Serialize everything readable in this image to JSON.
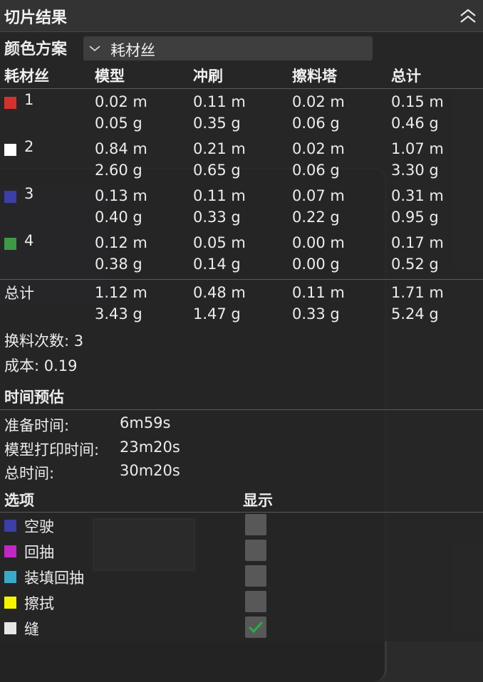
{
  "header": {
    "title": "切片结果"
  },
  "scheme": {
    "label": "颜色方案",
    "value": "耗材丝"
  },
  "columns": [
    "耗材丝",
    "模型",
    "冲刷",
    "擦料塔",
    "总计"
  ],
  "filaments": [
    {
      "id": "1",
      "color": "#d2322d",
      "model": [
        "0.02 m",
        "0.05 g"
      ],
      "flush": [
        "0.11 m",
        "0.35 g"
      ],
      "tower": [
        "0.02 m",
        "0.06 g"
      ],
      "total": [
        "0.15 m",
        "0.46 g"
      ]
    },
    {
      "id": "2",
      "color": "#ffffff",
      "model": [
        "0.84 m",
        "2.60 g"
      ],
      "flush": [
        "0.21 m",
        "0.65 g"
      ],
      "tower": [
        "0.02 m",
        "0.06 g"
      ],
      "total": [
        "1.07 m",
        "3.30 g"
      ]
    },
    {
      "id": "3",
      "color": "#3b3fa6",
      "model": [
        "0.13 m",
        "0.40 g"
      ],
      "flush": [
        "0.11 m",
        "0.33 g"
      ],
      "tower": [
        "0.07 m",
        "0.22 g"
      ],
      "total": [
        "0.31 m",
        "0.95 g"
      ]
    },
    {
      "id": "4",
      "color": "#3e9a45",
      "model": [
        "0.12 m",
        "0.38 g"
      ],
      "flush": [
        "0.05 m",
        "0.14 g"
      ],
      "tower": [
        "0.00 m",
        "0.00 g"
      ],
      "total": [
        "0.17 m",
        "0.52 g"
      ]
    }
  ],
  "totals": {
    "label": "总计",
    "model": [
      "1.12 m",
      "3.43 g"
    ],
    "flush": [
      "0.48 m",
      "1.47 g"
    ],
    "tower": [
      "0.11 m",
      "0.33 g"
    ],
    "total": [
      "1.71 m",
      "5.24 g"
    ]
  },
  "summary": {
    "changes": "换料次数: 3",
    "cost": "成本: 0.19"
  },
  "time": {
    "title": "时间预估",
    "prepare_label": "准备时间:",
    "prepare_value": "6m59s",
    "model_label": "模型打印时间:",
    "model_value": "23m20s",
    "total_label": "总时间:",
    "total_value": "30m20s"
  },
  "options": {
    "header_option": "选项",
    "header_show": "显示",
    "items": [
      {
        "label": "空驶",
        "color": "#3b3fa6",
        "checked": false
      },
      {
        "label": "回抽",
        "color": "#c327c6",
        "checked": false
      },
      {
        "label": "装填回抽",
        "color": "#3aa9c9",
        "checked": false
      },
      {
        "label": "擦拭",
        "color": "#f4f400",
        "checked": false
      },
      {
        "label": "缝",
        "color": "#e6e6e6",
        "checked": true
      }
    ]
  }
}
